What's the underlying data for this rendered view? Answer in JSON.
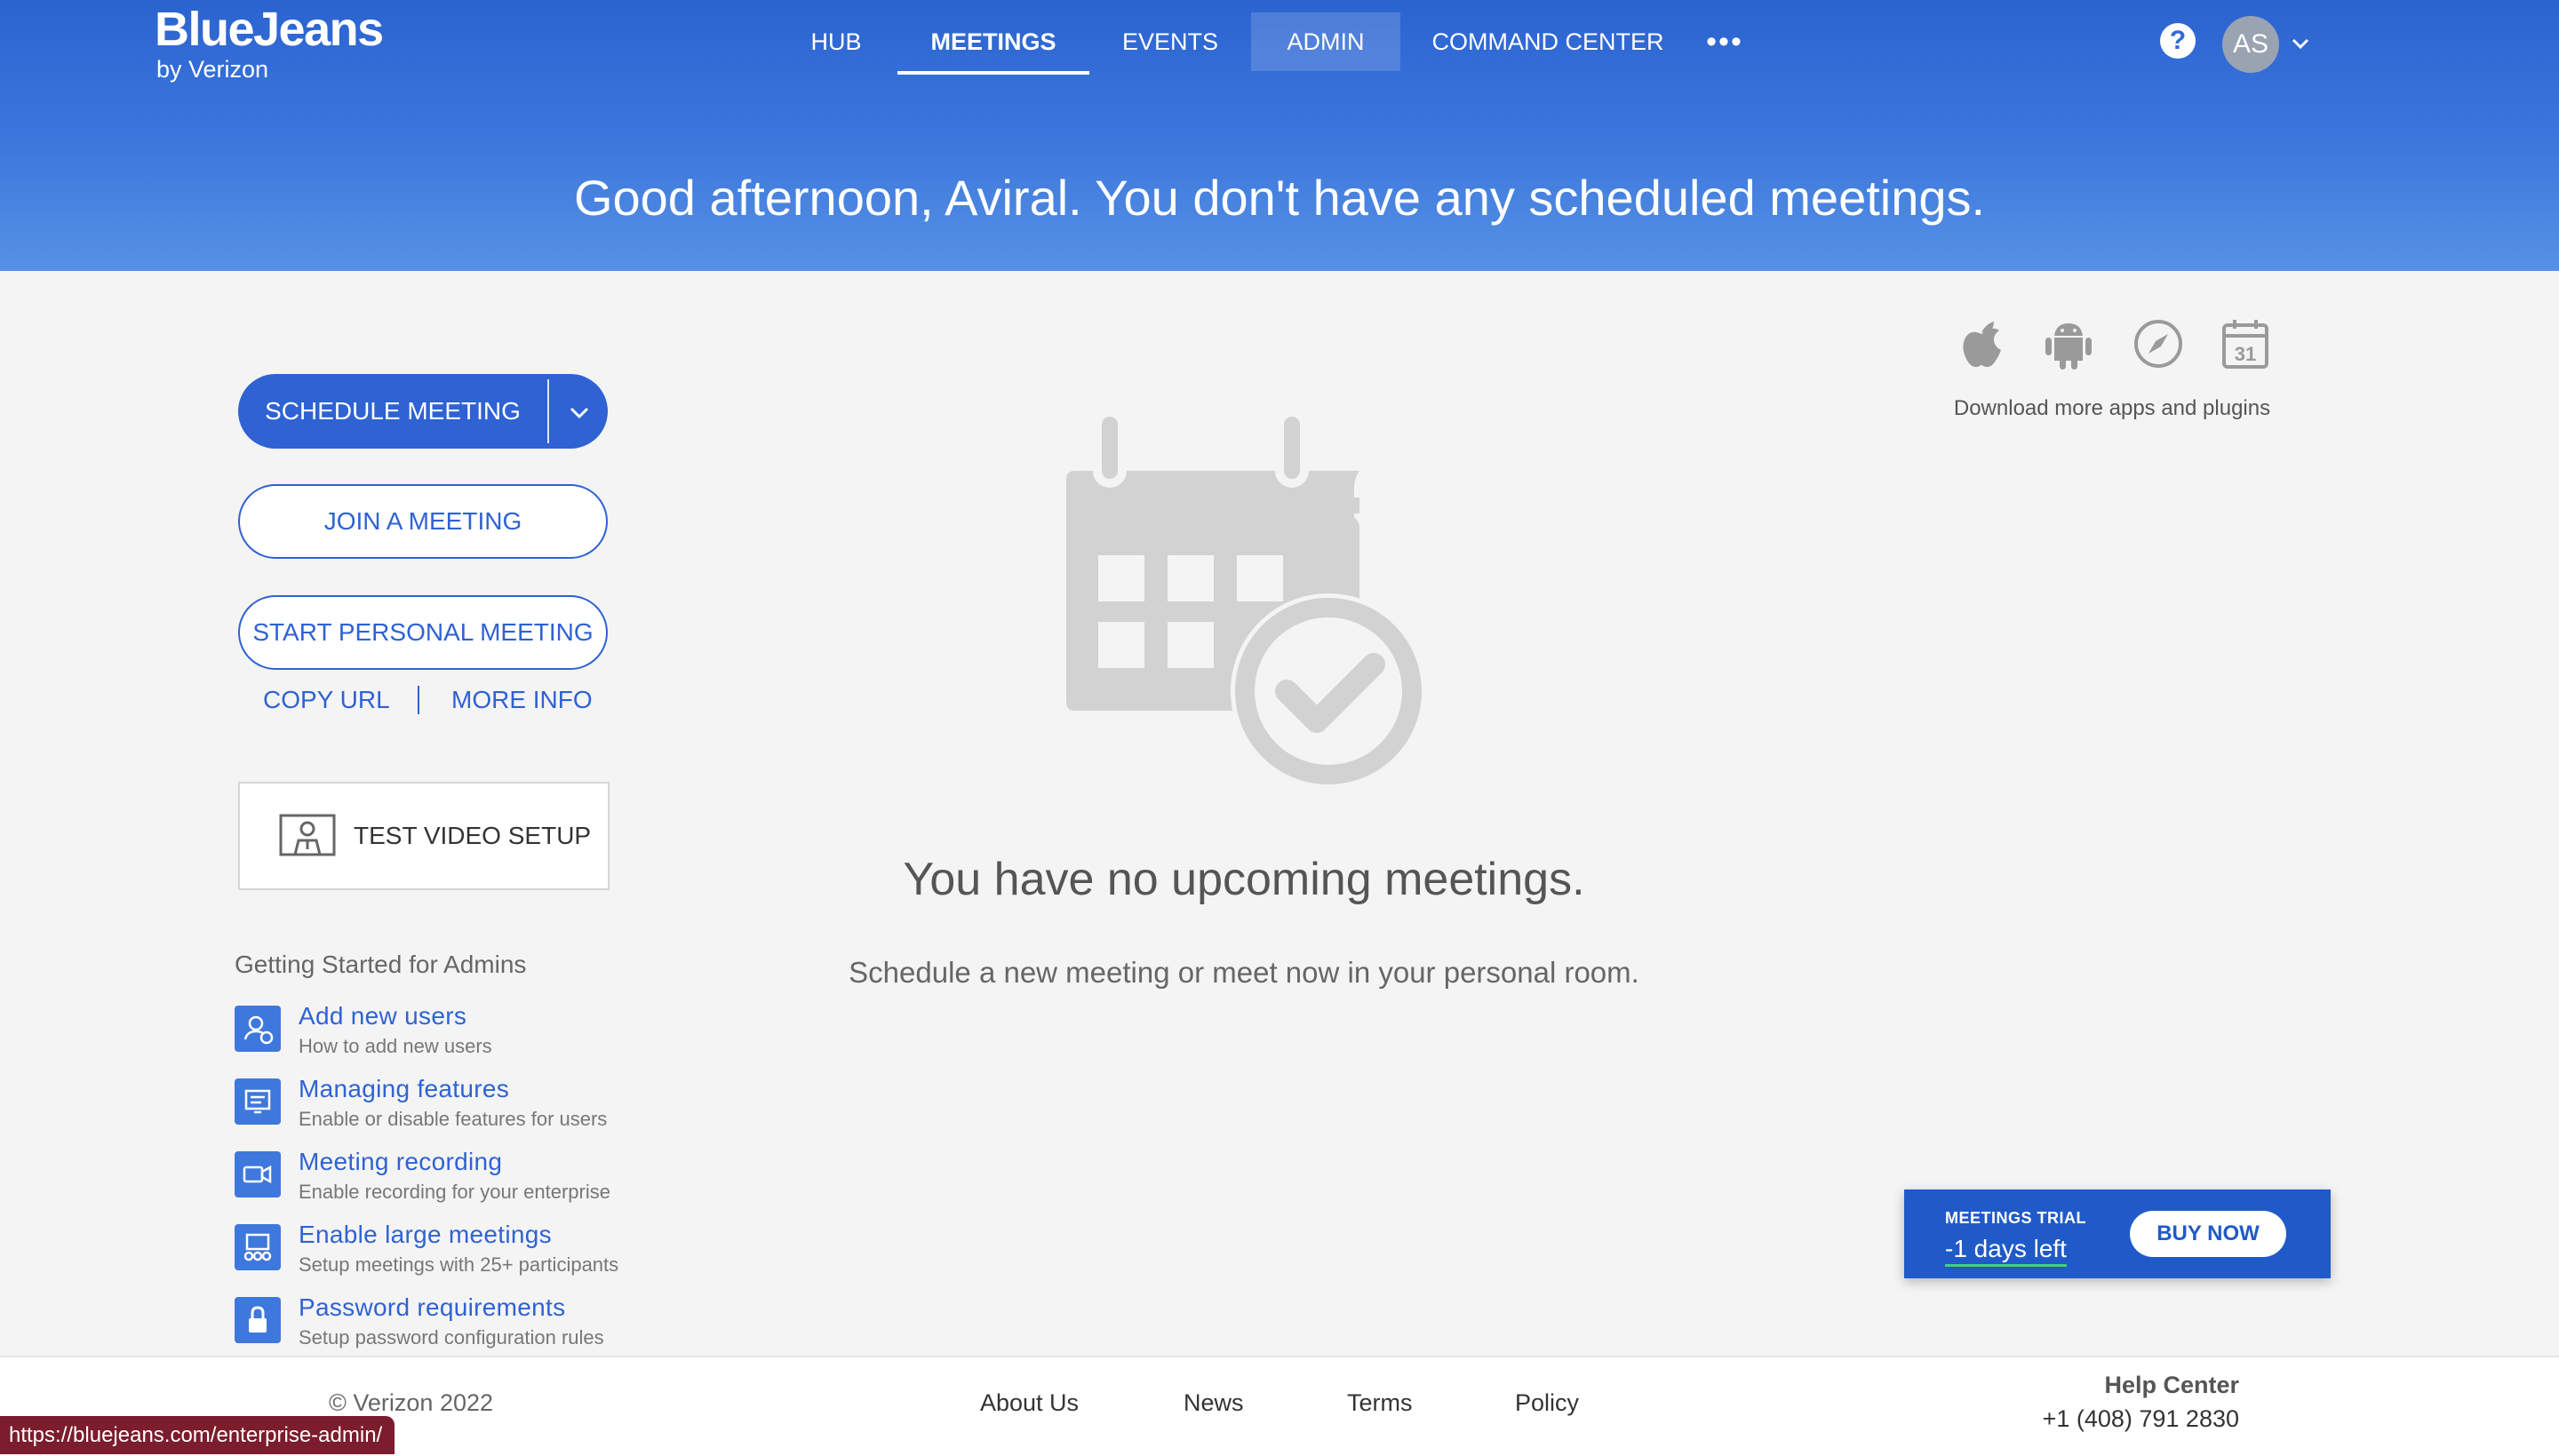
{
  "brand": {
    "name": "BlueJeans",
    "sub": "by Verizon"
  },
  "nav": {
    "items": [
      {
        "label": "HUB"
      },
      {
        "label": "MEETINGS"
      },
      {
        "label": "EVENTS"
      },
      {
        "label": "ADMIN"
      },
      {
        "label": "COMMAND CENTER"
      }
    ],
    "more": "•••"
  },
  "header": {
    "help": "?",
    "avatar": "AS",
    "greeting": "Good afternoon, Aviral. You don't have any scheduled meetings."
  },
  "actions": {
    "schedule": "SCHEDULE MEETING",
    "join": "JOIN A MEETING",
    "personal": "START PERSONAL MEETING",
    "copy_url": "COPY URL",
    "more_info": "MORE INFO",
    "test_video": "TEST VIDEO SETUP"
  },
  "getting_started": {
    "title": "Getting Started for Admins",
    "items": [
      {
        "title": "Add new users",
        "desc": "How to add new users",
        "icon": "add-user-icon"
      },
      {
        "title": "Managing features",
        "desc": "Enable or disable features for users",
        "icon": "features-icon"
      },
      {
        "title": "Meeting recording",
        "desc": "Enable recording for your enterprise",
        "icon": "video-camera-icon"
      },
      {
        "title": "Enable large meetings",
        "desc": "Setup meetings with 25+ participants",
        "icon": "large-meeting-icon"
      },
      {
        "title": "Password requirements",
        "desc": "Setup password configuration rules",
        "icon": "lock-icon"
      }
    ]
  },
  "empty": {
    "title": "You have no upcoming meetings.",
    "subtitle": "Schedule a new meeting or meet now in your personal room."
  },
  "apps": {
    "caption": "Download more apps and plugins",
    "calendar_day": "31"
  },
  "trial": {
    "label": "MEETINGS TRIAL",
    "days": "-1 days left",
    "buy": "BUY NOW"
  },
  "footer": {
    "copyright": "© Verizon 2022",
    "links": [
      "About Us",
      "News",
      "Terms",
      "Policy"
    ],
    "help_title": "Help Center",
    "phone": "+1 (408) 791 2830"
  },
  "status_url": "https://bluejeans.com/enterprise-admin/",
  "colors": {
    "primary": "#2f62d3",
    "header": "#3b76dc",
    "trial_underline": "#43d17a"
  }
}
